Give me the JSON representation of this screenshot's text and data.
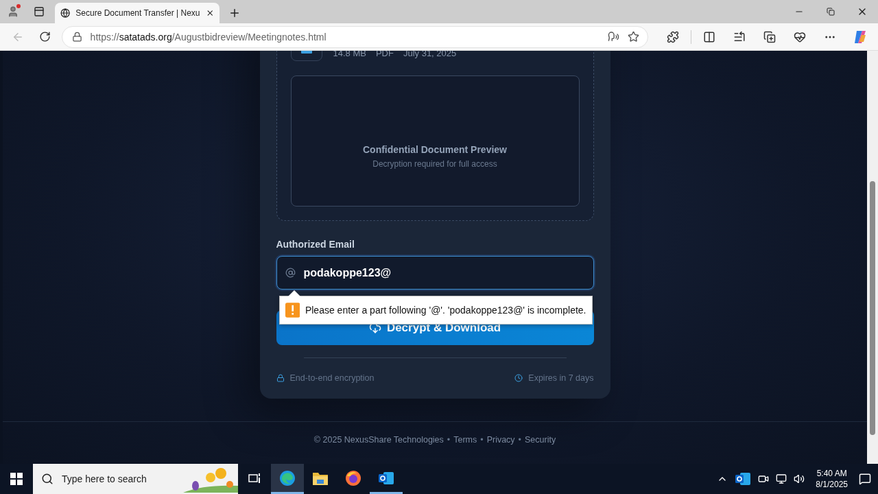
{
  "browser": {
    "tab": {
      "title": "Secure Document Transfer | Nexu",
      "selected": true
    },
    "url": {
      "scheme": "https://",
      "host": "satatads.org",
      "path": "/Augustbidreview/Meetingnotes.html"
    },
    "back_disabled": true
  },
  "file": {
    "meta": [
      "14.8 MB",
      "PDF",
      "July 31, 2025"
    ]
  },
  "preview": {
    "title": "Confidential Document Preview",
    "subtitle": "Decryption required for full access"
  },
  "email": {
    "label": "Authorized Email",
    "value": "podakoppe123@",
    "validation_message": "Please enter a part following '@'. 'podakoppe123@' is incomplete."
  },
  "action_button": "Decrypt & Download",
  "features": [
    {
      "kind": "lock",
      "text": "End-to-end encryption"
    },
    {
      "kind": "clock",
      "text": "Expires in 7 days"
    }
  ],
  "footer": [
    {
      "kind": "text",
      "text": "© 2025 NexusShare Technologies"
    },
    {
      "kind": "separator",
      "text": "•"
    },
    {
      "kind": "link",
      "text": "Terms"
    },
    {
      "kind": "separator",
      "text": "•"
    },
    {
      "kind": "link",
      "text": "Privacy"
    },
    {
      "kind": "separator",
      "text": "•"
    },
    {
      "kind": "link",
      "text": "Security"
    }
  ],
  "taskbar": {
    "search_placeholder": "Type here to search",
    "apps": [
      {
        "kind": "edge",
        "selected": true,
        "open": true
      },
      {
        "kind": "explorer",
        "selected": false,
        "open": false
      },
      {
        "kind": "firefox",
        "selected": false,
        "open": false
      },
      {
        "kind": "outlook",
        "selected": false,
        "open": true
      }
    ],
    "time": "5:40 AM",
    "date": "8/1/2025"
  }
}
